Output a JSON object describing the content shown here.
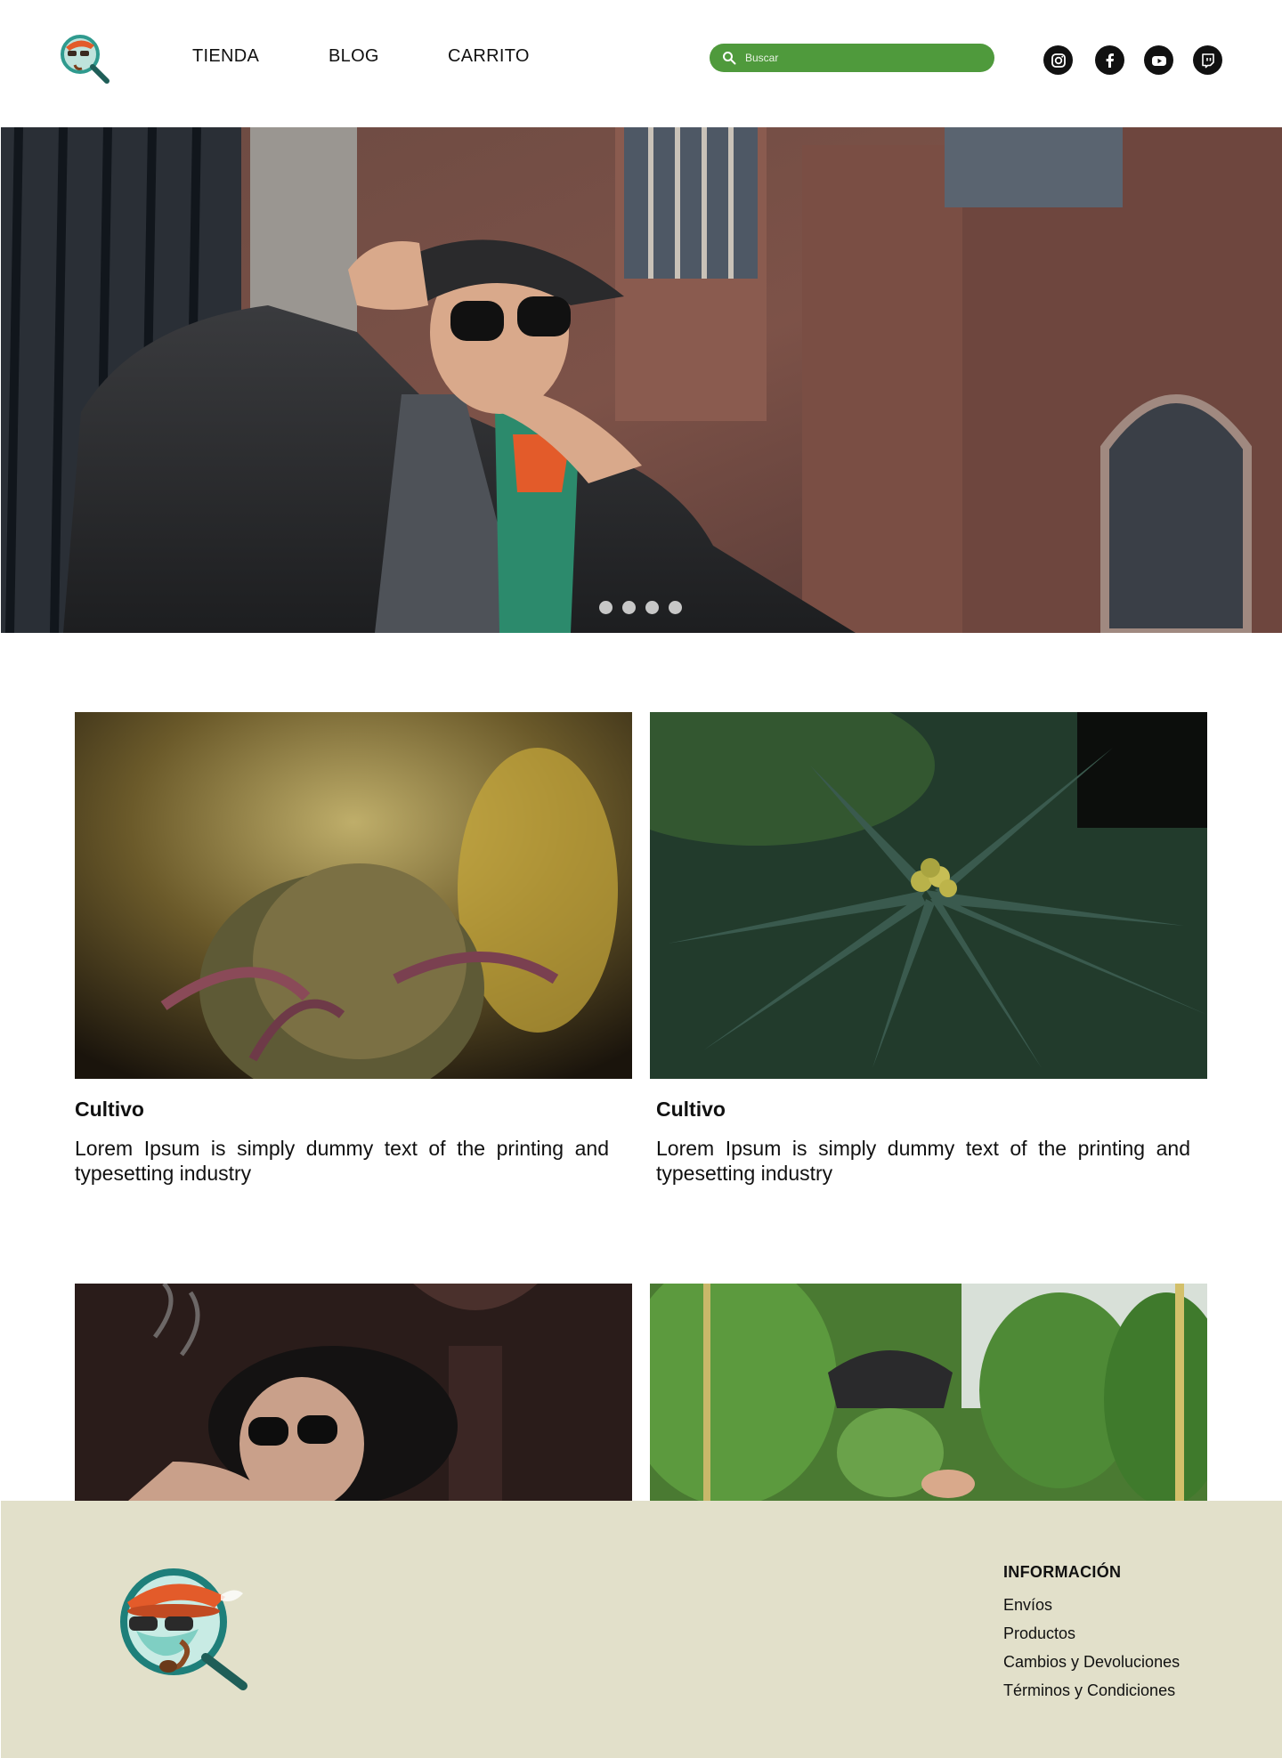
{
  "header": {
    "nav": [
      {
        "label": "TIENDA"
      },
      {
        "label": "BLOG"
      },
      {
        "label": "CARRITO"
      }
    ],
    "search": {
      "placeholder": "Buscar"
    },
    "social": [
      "instagram-icon",
      "facebook-icon",
      "youtube-icon",
      "twitch-icon"
    ]
  },
  "hero": {
    "slides": 4,
    "active_slide": 1
  },
  "cards": [
    {
      "title": "Cultivo",
      "text": "Lorem Ipsum is simply dummy text of the printing and typesetting industry"
    },
    {
      "title": "Cultivo",
      "text": "Lorem Ipsum is simply dummy text of the printing and typesetting industry"
    }
  ],
  "footer": {
    "heading": "INFORMACIÓN",
    "links": [
      "Envíos",
      "Productos",
      "Cambios y Devoluciones",
      "Términos y Condiciones"
    ]
  },
  "colors": {
    "accent": "#4f9a3c",
    "footer_bg": "#e2e0ca",
    "logo_orange": "#e35b2a",
    "logo_teal": "#2f9a8e"
  }
}
